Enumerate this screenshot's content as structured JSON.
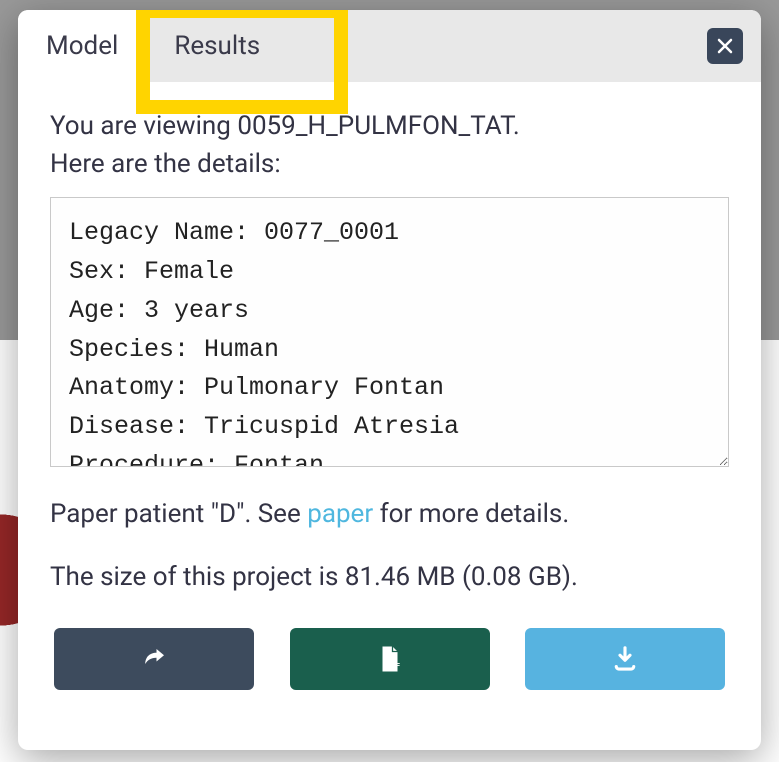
{
  "tabs": {
    "model": "Model",
    "results": "Results"
  },
  "intro_line1_prefix": "You are viewing ",
  "intro_line1_id": "0059_H_PULMFON_TAT",
  "intro_line1_suffix": ".",
  "intro_line2": "Here are the details:",
  "details_text": "Legacy Name: 0077_0001\nSex: Female\nAge: 3 years\nSpecies: Human\nAnatomy: Pulmonary Fontan\nDisease: Tricuspid Atresia\nProcedure: Fontan",
  "notes_prefix": "Paper patient \"D\". See ",
  "notes_link": "paper",
  "notes_suffix": " for more details.",
  "size_prefix": "The size of this project is ",
  "size_mb": "81.46 MB",
  "size_gb": "(0.08 GB)",
  "size_suffix": "."
}
